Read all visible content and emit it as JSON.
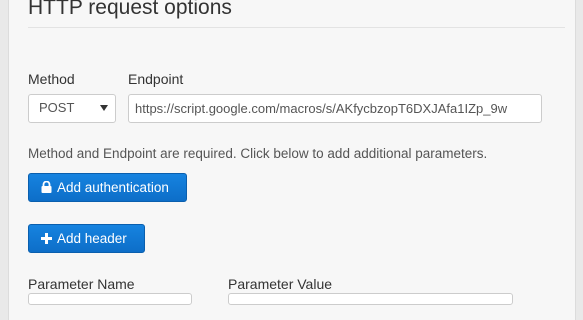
{
  "section": {
    "title": "HTTP request options"
  },
  "method": {
    "label": "Method",
    "selected": "POST"
  },
  "endpoint": {
    "label": "Endpoint",
    "value": "https://script.google.com/macros/s/AKfycbzopT6DXJAfa1IZp_9w"
  },
  "help_text": "Method and Endpoint are required. Click below to add additional parameters.",
  "buttons": {
    "add_authentication": "Add authentication",
    "add_header": "Add header"
  },
  "parameters": {
    "name_label": "Parameter Name",
    "value_label": "Parameter Value"
  },
  "colors": {
    "primary_button": "#0d6ec8",
    "panel_background": "#f7f7f7"
  },
  "icons": {
    "auth": "lock-icon",
    "header": "plus-icon",
    "select": "caret-down-icon"
  }
}
